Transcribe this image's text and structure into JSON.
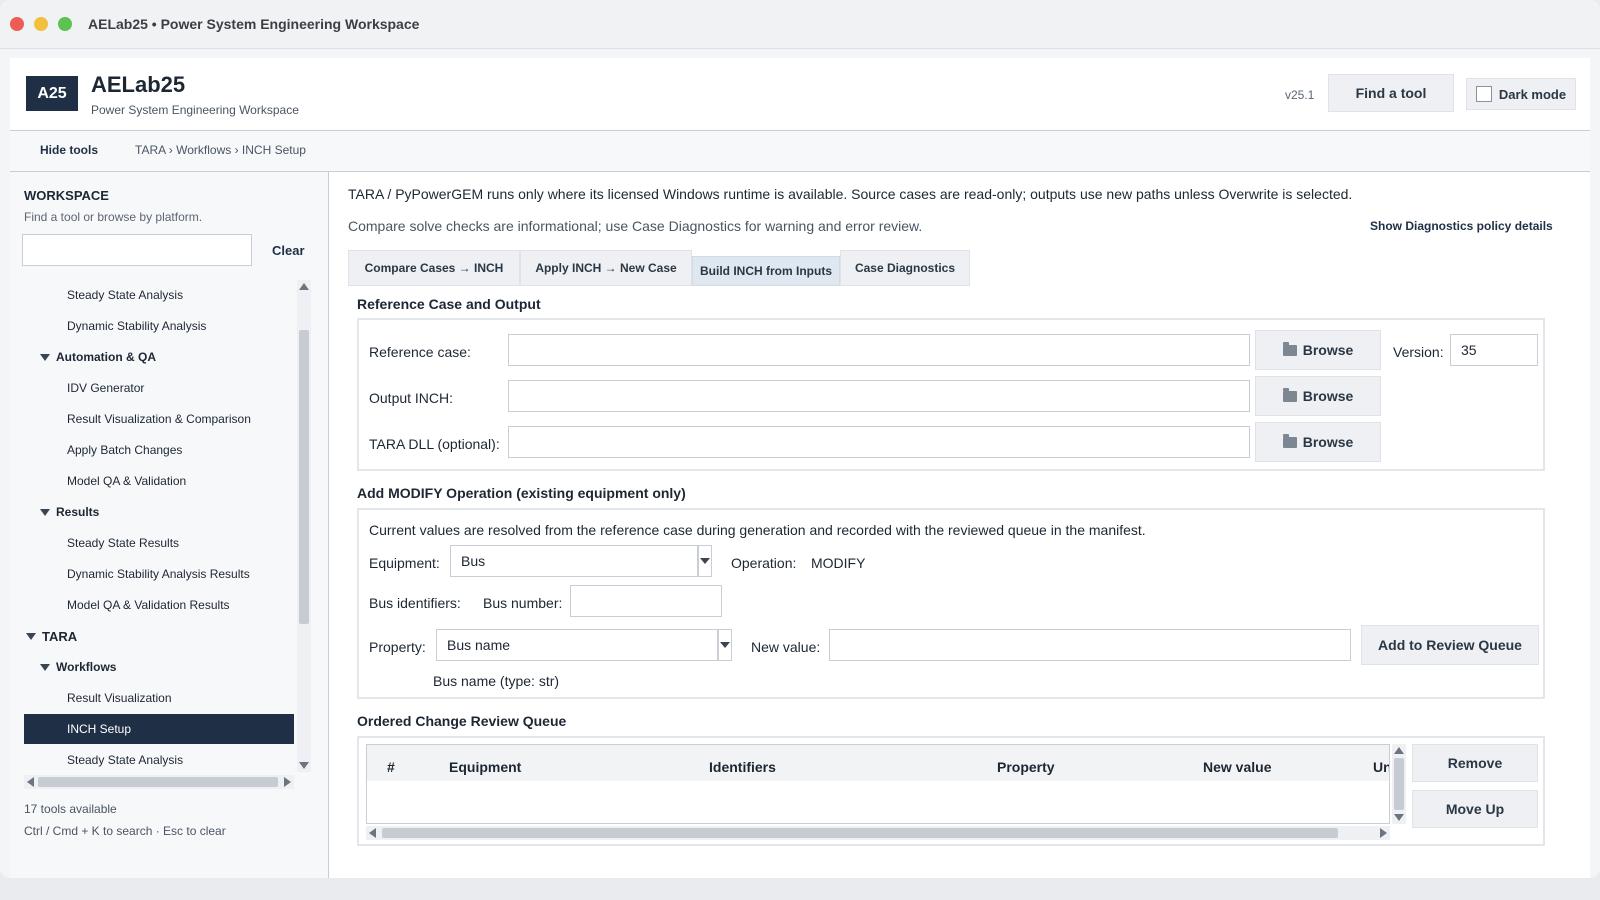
{
  "window": {
    "title": "AELab25 • Power System Engineering Workspace"
  },
  "header": {
    "logo": "A25",
    "title": "AELab25",
    "subtitle": "Power System Engineering Workspace",
    "version": "v25.1",
    "find_tool": "Find a tool",
    "dark_mode": "Dark mode"
  },
  "toolbar": {
    "hide_tools": "Hide tools",
    "breadcrumb": "TARA › Workflows › INCH Setup"
  },
  "sidebar": {
    "title": "WORKSPACE",
    "subtitle": "Find a tool or browse by platform.",
    "search_placeholder": "",
    "clear": "Clear",
    "items": [
      {
        "label": "Steady State Analysis",
        "level": 2
      },
      {
        "label": "Dynamic Stability Analysis",
        "level": 2
      },
      {
        "label": "Automation & QA",
        "level": 1
      },
      {
        "label": "IDV Generator",
        "level": 2
      },
      {
        "label": "Result Visualization & Comparison",
        "level": 2
      },
      {
        "label": "Apply Batch Changes",
        "level": 2
      },
      {
        "label": "Model QA & Validation",
        "level": 2
      },
      {
        "label": "Results",
        "level": 1
      },
      {
        "label": "Steady State Results",
        "level": 2
      },
      {
        "label": "Dynamic Stability Analysis Results",
        "level": 2
      },
      {
        "label": "Model QA & Validation Results",
        "level": 2
      },
      {
        "label": "TARA",
        "level": 0
      },
      {
        "label": "Workflows",
        "level": 1
      },
      {
        "label": "Result Visualization",
        "level": 2
      },
      {
        "label": "INCH Setup",
        "level": 2,
        "selected": true
      },
      {
        "label": "Steady State Analysis",
        "level": 2
      }
    ],
    "count": "17 tools available",
    "hint": "Ctrl / Cmd + K to search · Esc to clear"
  },
  "main": {
    "notice": "TARA / PyPowerGEM runs only where its licensed Windows runtime is available. Source cases are read-only; outputs use new paths unless Overwrite is selected.",
    "notice2": "Compare solve checks are informational; use Case Diagnostics for warning and error review.",
    "policy_link": "Show Diagnostics policy details",
    "tabs": [
      {
        "label": "Compare Cases → INCH"
      },
      {
        "label": "Apply INCH → New Case"
      },
      {
        "label": "Build INCH from Inputs",
        "active": true
      },
      {
        "label": "Case Diagnostics"
      }
    ]
  },
  "reference": {
    "title": "Reference Case and Output",
    "reference_case_label": "Reference case:",
    "reference_case_value": "",
    "output_inch_label": "Output INCH:",
    "output_inch_value": "",
    "tara_dll_label": "TARA DLL (optional):",
    "tara_dll_value": "",
    "browse": "Browse",
    "version_label": "Version:",
    "version_value": "35"
  },
  "modify": {
    "title": "Add MODIFY Operation (existing equipment only)",
    "note": "Current values are resolved from the reference case during generation and recorded with the reviewed queue in the manifest.",
    "equipment_label": "Equipment:",
    "equipment_value": "Bus",
    "operation_label": "Operation:",
    "operation_value": "MODIFY",
    "identifiers_label": "Bus identifiers:",
    "bus_number_label": "Bus number:",
    "bus_number_value": "",
    "property_label": "Property:",
    "property_value": "Bus name",
    "new_value_label": "New value:",
    "new_value_value": "",
    "add_button": "Add to Review Queue",
    "type_hint": "Bus name (type: str)"
  },
  "queue": {
    "title": "Ordered Change Review Queue",
    "columns": [
      "#",
      "Equipment",
      "Identifiers",
      "Property",
      "New value",
      "Un"
    ],
    "remove": "Remove",
    "move_up": "Move Up"
  }
}
